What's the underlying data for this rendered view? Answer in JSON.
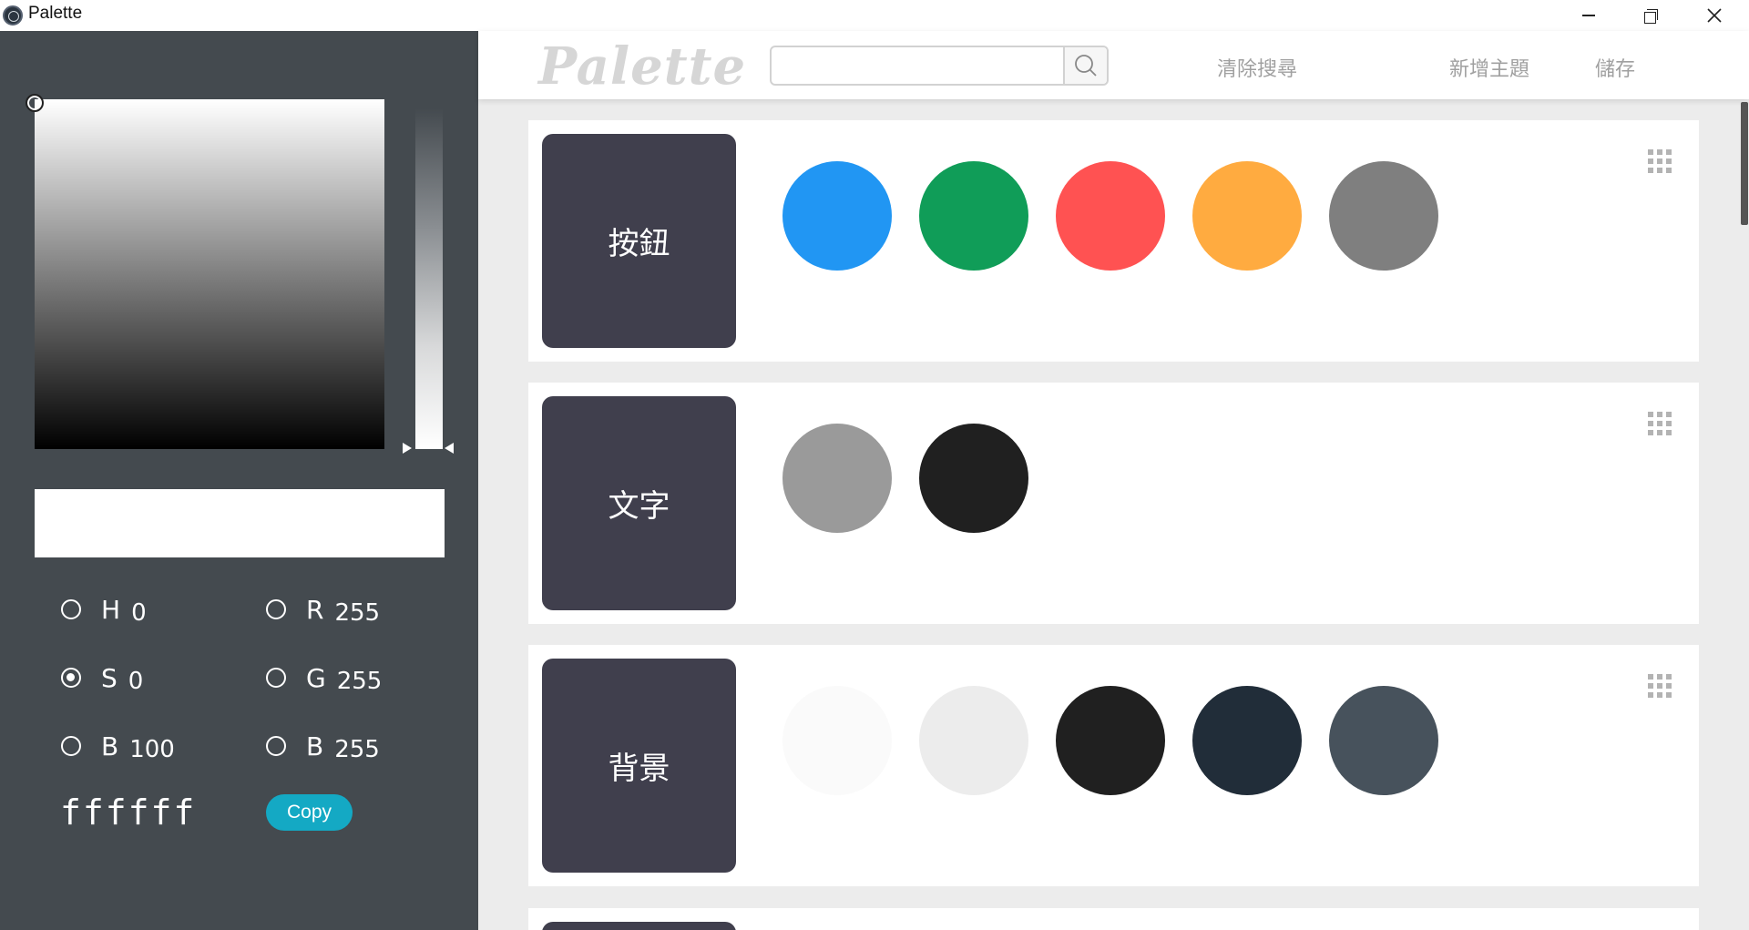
{
  "window": {
    "title": "Palette"
  },
  "header": {
    "logo": "Palette",
    "search": {
      "value": "",
      "placeholder": ""
    },
    "clear_search": "清除搜尋",
    "add_theme": "新增主題",
    "save": "儲存"
  },
  "picker": {
    "current_color": "#ffffff",
    "fields": [
      {
        "letter": "H",
        "value": "0",
        "checked": false
      },
      {
        "letter": "S",
        "value": "0",
        "checked": true
      },
      {
        "letter": "B",
        "value": "100",
        "checked": false
      },
      {
        "letter": "R",
        "value": "255",
        "checked": false
      },
      {
        "letter": "G",
        "value": "255",
        "checked": false
      },
      {
        "letter": "B",
        "value": "255",
        "checked": false
      }
    ],
    "hex": "ffffff",
    "copy_label": "Copy"
  },
  "themes": [
    {
      "name": "按鈕",
      "colors": [
        "#2196f3",
        "#109d58",
        "#ff5252",
        "#ffab40",
        "#7f7f7f"
      ]
    },
    {
      "name": "文字",
      "colors": [
        "#9a9a9a",
        "#202020"
      ]
    },
    {
      "name": "背景",
      "colors": [
        "#fafafa",
        "#ececec",
        "#202020",
        "#212d39",
        "#47525c"
      ]
    }
  ],
  "icons": {
    "search": "search-icon",
    "drag": "drag-handle-icon",
    "minimize": "minimize-icon",
    "maximize": "restore-icon",
    "close": "close-icon"
  }
}
